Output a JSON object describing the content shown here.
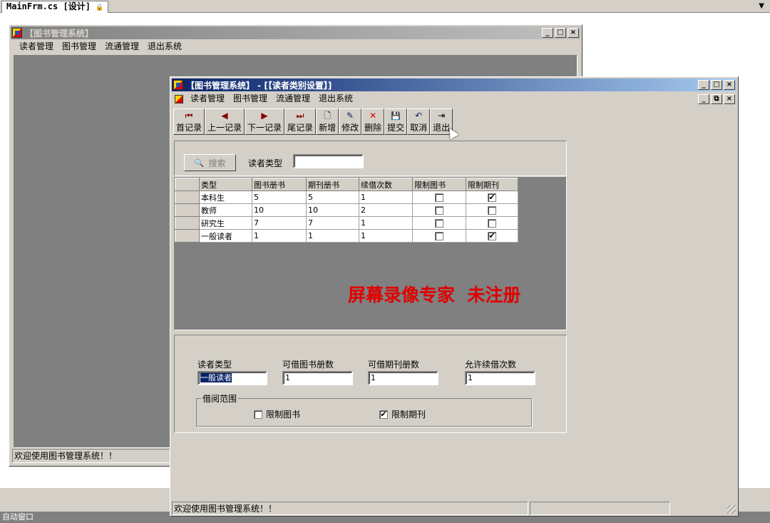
{
  "ide": {
    "tab_label": "MainFrm.cs [设计]",
    "tab_lock_icon": "lock-icon",
    "dropdown_icon": "chevron-down-icon",
    "status_text": "自动窗口"
  },
  "main_window": {
    "title": "【图书管理系统】",
    "menu": [
      "读者管理",
      "图书管理",
      "流通管理",
      "退出系统"
    ],
    "status_text": "欢迎使用图书管理系统！！",
    "caption_buttons": [
      "_",
      "□",
      "×"
    ],
    "client_color": "#808080"
  },
  "child_window": {
    "title": "【图书管理系统】 - [【读者类别设置】]",
    "menu": [
      "读者管理",
      "图书管理",
      "流通管理",
      "退出系统"
    ],
    "caption_buttons": [
      "_",
      "□",
      "×"
    ],
    "mdi_buttons": [
      "_",
      "⧉",
      "×"
    ],
    "toolbar": [
      {
        "label": "首记录",
        "icon": "first-record-icon",
        "glyph": "⏮"
      },
      {
        "label": "上一记录",
        "icon": "previous-record-icon",
        "glyph": "◀"
      },
      {
        "label": "下一记录",
        "icon": "next-record-icon",
        "glyph": "▶"
      },
      {
        "label": "尾记录",
        "icon": "last-record-icon",
        "glyph": "⏭"
      },
      {
        "label": "新增",
        "icon": "new-document-icon",
        "glyph": "🗋"
      },
      {
        "label": "修改",
        "icon": "edit-icon",
        "glyph": "✎"
      },
      {
        "label": "删除",
        "icon": "delete-icon",
        "glyph": "✕"
      },
      {
        "label": "提交",
        "icon": "save-icon",
        "glyph": "💾"
      },
      {
        "label": "取消",
        "icon": "undo-icon",
        "glyph": "↶"
      },
      {
        "label": "退出",
        "icon": "exit-icon",
        "glyph": "⇥"
      }
    ],
    "search": {
      "button_label": "搜索",
      "field_label": "读者类型",
      "field_value": ""
    },
    "grid": {
      "columns": [
        "类型",
        "图书册书",
        "期刊册书",
        "续借次数",
        "限制图书",
        "限制期刊"
      ],
      "rows": [
        {
          "type": "本科生",
          "books": "5",
          "periodicals": "5",
          "renewals": "1",
          "limit_books": false,
          "limit_periodicals": true
        },
        {
          "type": "教师",
          "books": "10",
          "periodicals": "10",
          "renewals": "2",
          "limit_books": false,
          "limit_periodicals": false
        },
        {
          "type": "研究生",
          "books": "7",
          "periodicals": "7",
          "renewals": "1",
          "limit_books": false,
          "limit_periodicals": false
        },
        {
          "type": "一般读者",
          "books": "1",
          "periodicals": "1",
          "renewals": "1",
          "limit_books": false,
          "limit_periodicals": true
        }
      ]
    },
    "watermark": "屏幕录像专家  未注册",
    "form": {
      "reader_type_label": "读者类型",
      "reader_type_value": "一般读者",
      "books_label": "可借图书册数",
      "books_value": "1",
      "periodicals_label": "可借期刊册数",
      "periodicals_value": "1",
      "renewals_label": "允许续借次数",
      "renewals_value": "1",
      "scope_label": "借阅范围",
      "limit_books_label": "限制图书",
      "limit_books_checked": false,
      "limit_periodicals_label": "限制期刊",
      "limit_periodicals_checked": true
    },
    "status_text": "欢迎使用图书管理系统！！"
  }
}
